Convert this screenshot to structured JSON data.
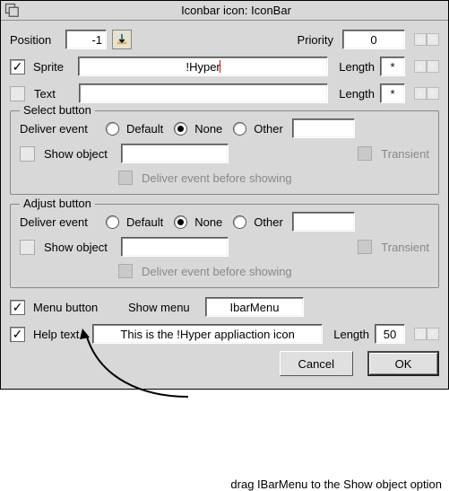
{
  "title": "Iconbar icon: IconBar",
  "position": {
    "label": "Position",
    "value": "-1"
  },
  "priority": {
    "label": "Priority",
    "value": "0"
  },
  "sprite": {
    "label": "Sprite",
    "value": "!Hyper",
    "length_label": "Length",
    "length_value": "*"
  },
  "text": {
    "label": "Text",
    "value": "",
    "length_label": "Length",
    "length_value": "*"
  },
  "select_group": {
    "legend": "Select button",
    "deliver_label": "Deliver event",
    "opt_default": "Default",
    "opt_none": "None",
    "opt_other": "Other",
    "other_value": "",
    "show_object_label": "Show object",
    "show_object_value": "",
    "transient_label": "Transient",
    "before_label": "Deliver event before showing"
  },
  "adjust_group": {
    "legend": "Adjust button",
    "deliver_label": "Deliver event",
    "opt_default": "Default",
    "opt_none": "None",
    "opt_other": "Other",
    "other_value": "",
    "show_object_label": "Show object",
    "show_object_value": "",
    "transient_label": "Transient",
    "before_label": "Deliver event before showing"
  },
  "menu_button_label": "Menu button",
  "show_menu_label": "Show menu",
  "show_menu_value": "IbarMenu",
  "help_text_label": "Help text",
  "help_text_value": "This is the !Hyper appliaction icon",
  "help_length_label": "Length",
  "help_length_value": "50",
  "cancel_label": "Cancel",
  "ok_label": "OK",
  "caption": "drag IBarMenu to the Show object option"
}
